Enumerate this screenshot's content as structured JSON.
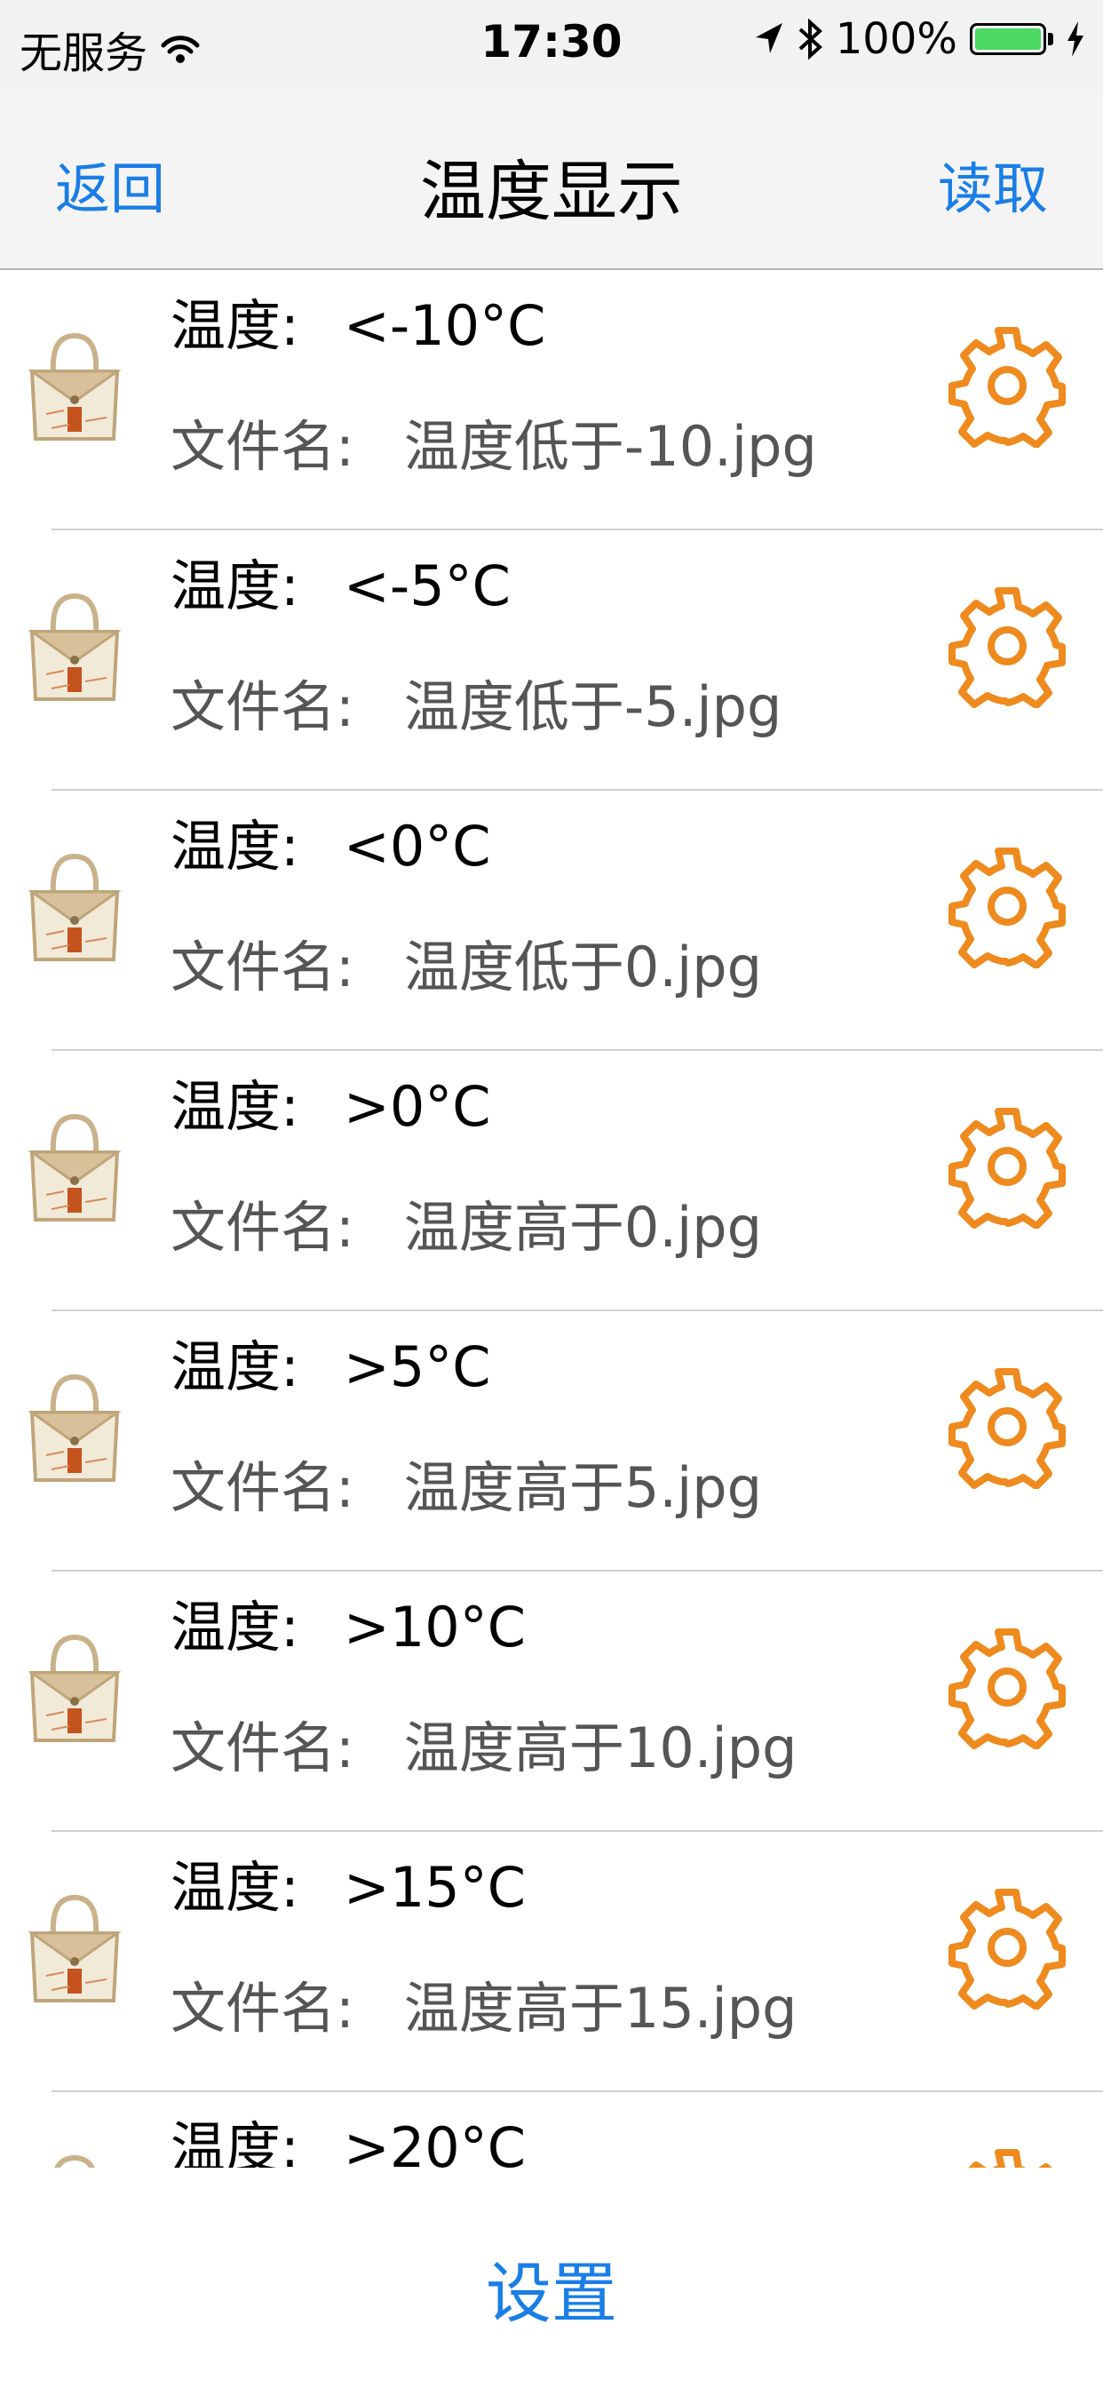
{
  "status_bar": {
    "carrier": "无服务",
    "time": "17:30",
    "battery": "100%",
    "icons": [
      "wifi-icon",
      "location-arrow-icon",
      "bluetooth-icon",
      "battery-icon",
      "charging-bolt-icon"
    ]
  },
  "nav": {
    "back_label": "返回",
    "title": "温度显示",
    "read_label": "读取"
  },
  "rows": [
    {
      "temp_label": "温度:",
      "temp": "<-10°C",
      "file_label": "文件名:",
      "file": "温度低于-10.jpg"
    },
    {
      "temp_label": "温度:",
      "temp": "<-5°C",
      "file_label": "文件名:",
      "file": "温度低于-5.jpg"
    },
    {
      "temp_label": "温度:",
      "temp": "<0°C",
      "file_label": "文件名:",
      "file": "温度低于0.jpg"
    },
    {
      "temp_label": "温度:",
      "temp": ">0°C",
      "file_label": "文件名:",
      "file": "温度高于0.jpg"
    },
    {
      "temp_label": "温度:",
      "temp": ">5°C",
      "file_label": "文件名:",
      "file": "温度高于5.jpg"
    },
    {
      "temp_label": "温度:",
      "temp": ">10°C",
      "file_label": "文件名:",
      "file": "温度高于10.jpg"
    },
    {
      "temp_label": "温度:",
      "temp": ">15°C",
      "file_label": "文件名:",
      "file": "温度高于15.jpg"
    },
    {
      "temp_label": "温度:",
      "temp": ">20°C",
      "file_label": "文件名:",
      "file": ""
    }
  ],
  "footer": {
    "settings_label": "设置"
  },
  "colors": {
    "accent": "#1a7ee6",
    "gear": "#ee8a1e",
    "battery": "#4cd964"
  }
}
